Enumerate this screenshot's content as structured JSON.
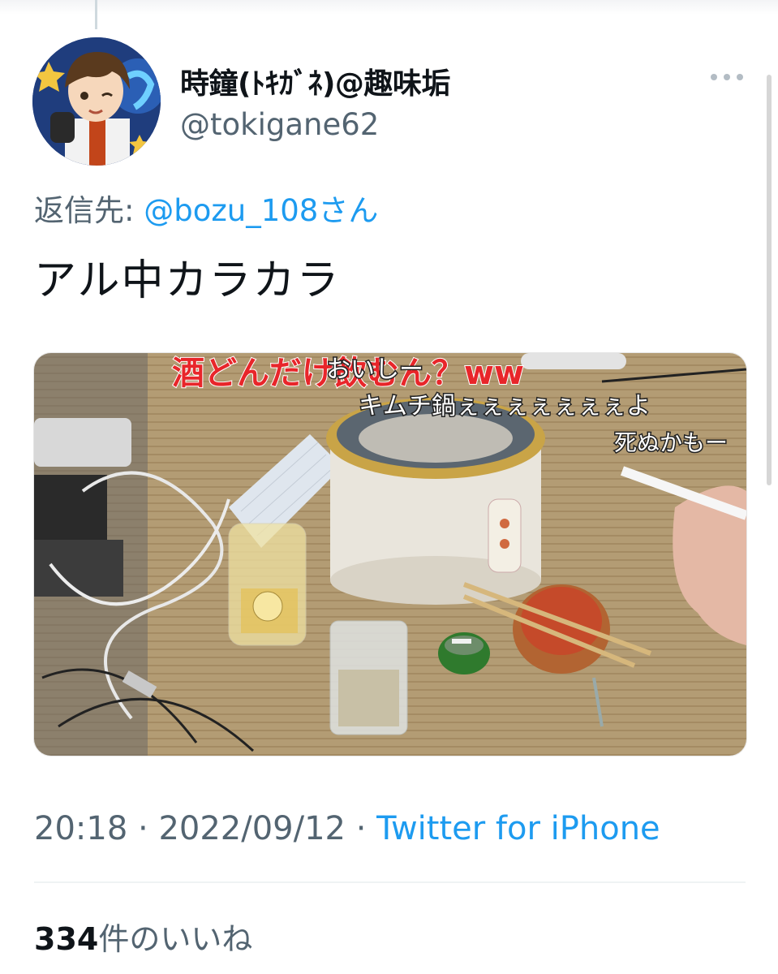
{
  "tweet": {
    "display_name": "時鐘(ﾄｷｶﾞﾈ)@趣味垢",
    "handle": "@tokigane62",
    "reply_prefix": "返信先: ",
    "reply_mention": "@bozu_108さん",
    "text": "アル中カラカラ",
    "time": "20:18",
    "date": "2022/09/12",
    "separator": " · ",
    "source": "Twitter for iPhone",
    "likes_count": "334",
    "likes_label": "件のいいね"
  },
  "media": {
    "overlay_red": "酒どんだけ飲むん？ww",
    "comment_1": "おいしー",
    "comment_2": "キムチ鍋ぇぇぇぇぇぇぇよ",
    "comment_3": "死ぬかもー"
  },
  "icons": [
    "more-options-icon",
    "avatar-image"
  ],
  "colors": {
    "link": "#1d9bf0",
    "secondary_text": "#536471",
    "primary_text": "#0f1419"
  }
}
